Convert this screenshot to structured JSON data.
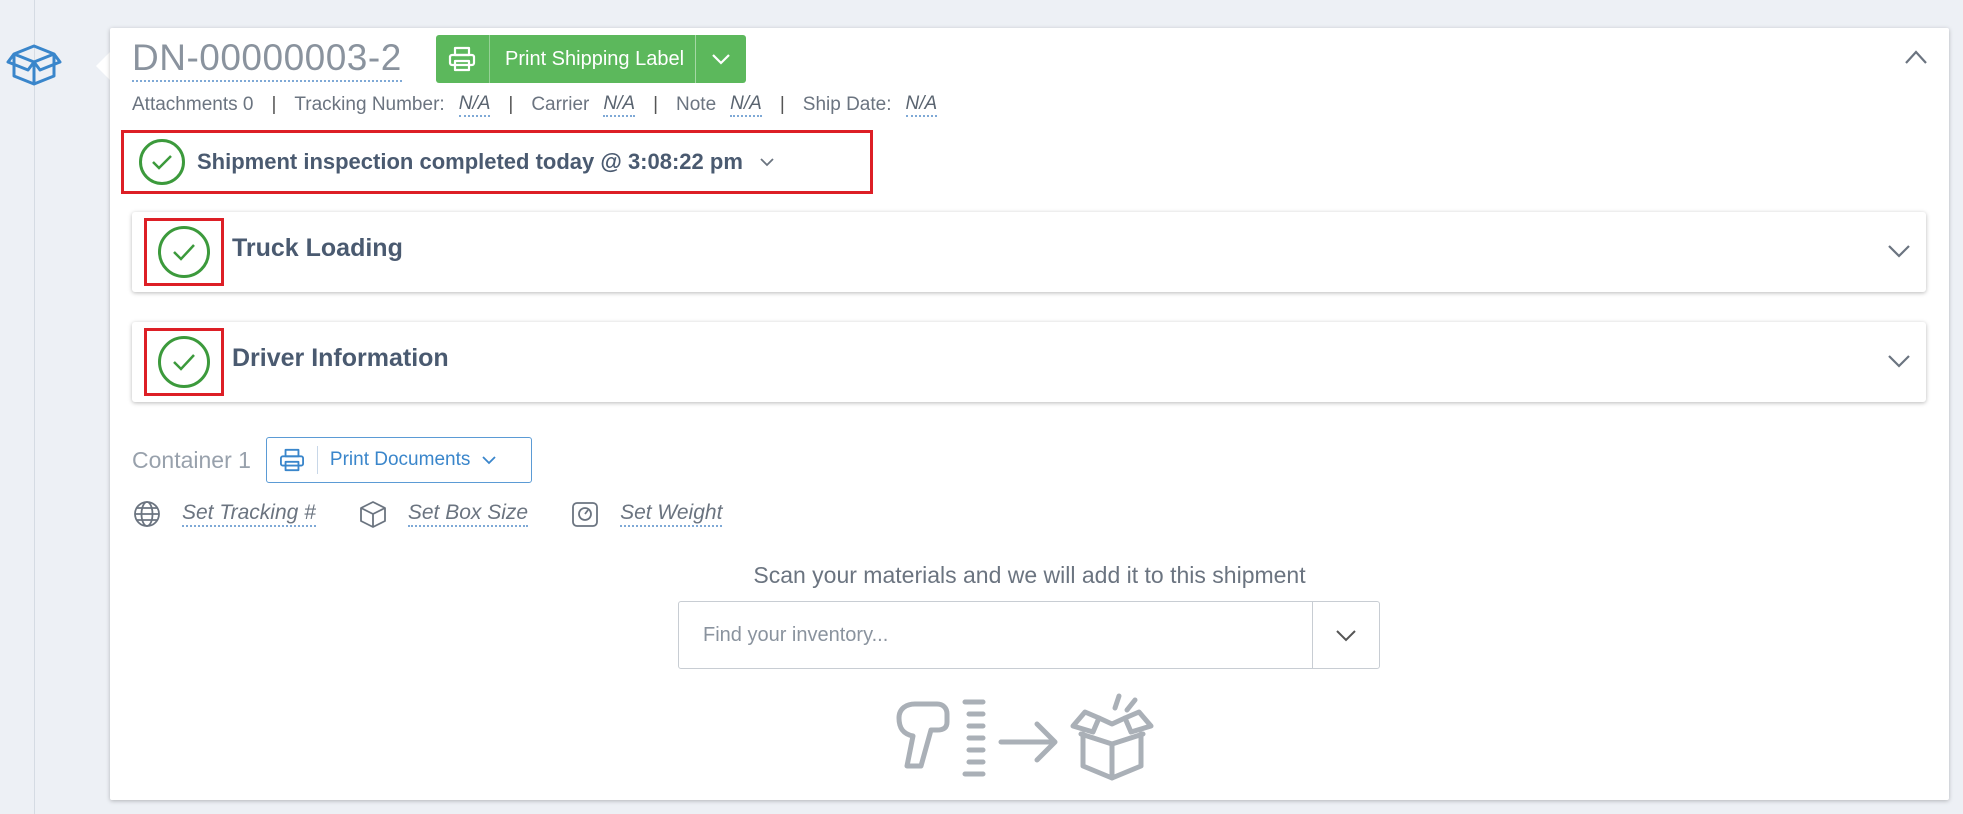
{
  "shipment": {
    "id": "DN-00000003-2",
    "print_label": "Print Shipping Label"
  },
  "meta": {
    "attachments": "Attachments 0",
    "tracking_label": "Tracking Number:",
    "tracking_value": "N/A",
    "carrier_label": "Carrier",
    "carrier_value": "N/A",
    "note_label": "Note",
    "note_value": "N/A",
    "ship_date_label": "Ship Date:",
    "ship_date_value": "N/A",
    "separator": "|"
  },
  "inspection": {
    "text": "Shipment inspection completed today @ 3:08:22 pm"
  },
  "panels": {
    "truck_loading": "Truck Loading",
    "driver_information": "Driver Information"
  },
  "container": {
    "label": "Container 1",
    "print_documents": "Print Documents",
    "set_tracking": "Set Tracking #",
    "set_box_size": "Set Box Size",
    "set_weight": "Set Weight"
  },
  "scan": {
    "prompt": "Scan your materials and we will add it to this shipment",
    "placeholder": "Find your inventory..."
  },
  "colors": {
    "success_green": "#5cb85c",
    "check_green": "#3c9a3c",
    "highlight_red": "#dd1f26",
    "link_blue": "#3a86cb"
  },
  "icons": {
    "side": "open-box-icon",
    "print": "printer-icon",
    "tracking": "globe-icon",
    "box_size": "cube-icon",
    "weight": "scale-icon",
    "illustration": "scanner-to-box-icon"
  }
}
